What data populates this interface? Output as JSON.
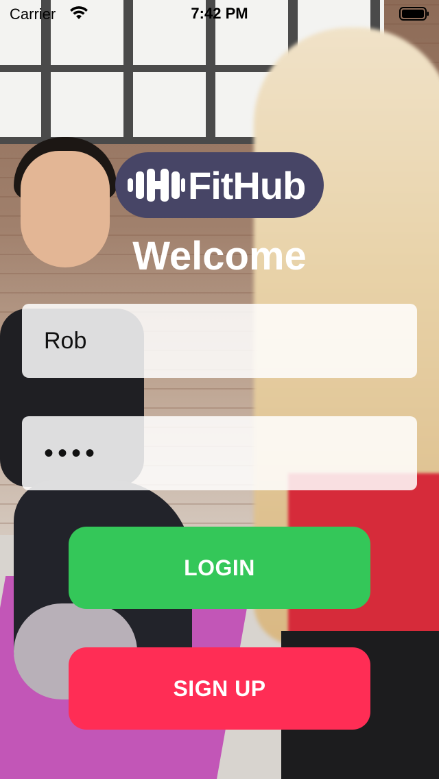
{
  "status_bar": {
    "carrier": "Carrier",
    "time": "7:42 PM",
    "icons": [
      "wifi-icon",
      "battery-icon"
    ]
  },
  "logo": {
    "text": "FitHub",
    "icon": "dumbbell-icon",
    "background_color": "#474566"
  },
  "welcome": "Welcome",
  "form": {
    "username_value": "Rob",
    "password_value": "••••"
  },
  "buttons": {
    "login_label": "LOGIN",
    "login_color": "#34c759",
    "signup_label": "SIGN UP",
    "signup_color": "#ff2d55"
  }
}
